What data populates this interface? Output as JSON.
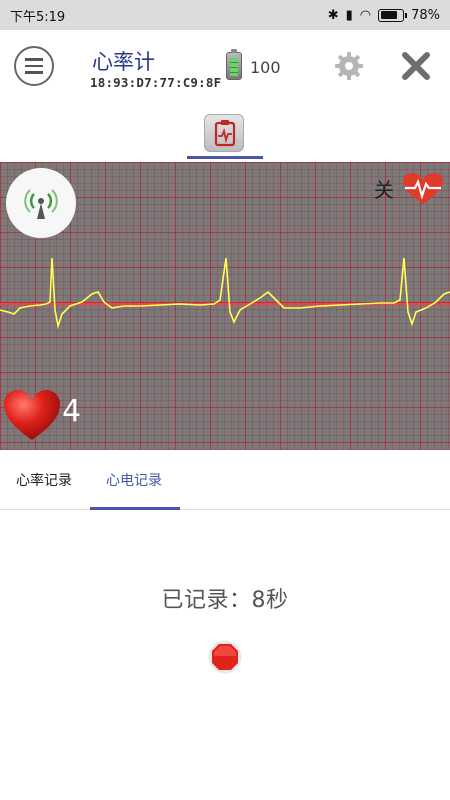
{
  "status": {
    "time": "下午5:19",
    "battery_text": "78%",
    "battery_level": 0.78,
    "icons": [
      "bluetooth-icon",
      "signal-icon",
      "wifi-icon",
      "battery-icon"
    ]
  },
  "header": {
    "title": "心率计",
    "mac": "18:93:D7:77:C9:8F",
    "device_battery": "100"
  },
  "ecg": {
    "toggle_label": "关",
    "heart_rate": "4",
    "colors": {
      "background": "#7a7a7a",
      "grid": "#b01822",
      "trace": "#ffff55",
      "baseline": "#ff3b3b"
    }
  },
  "tabs": [
    {
      "label": "心率记录"
    },
    {
      "label": "心电记录"
    }
  ],
  "record": {
    "label": "已记录：8秒"
  },
  "colors": {
    "accent": "#4a56a8",
    "stop": "#e0241b"
  }
}
